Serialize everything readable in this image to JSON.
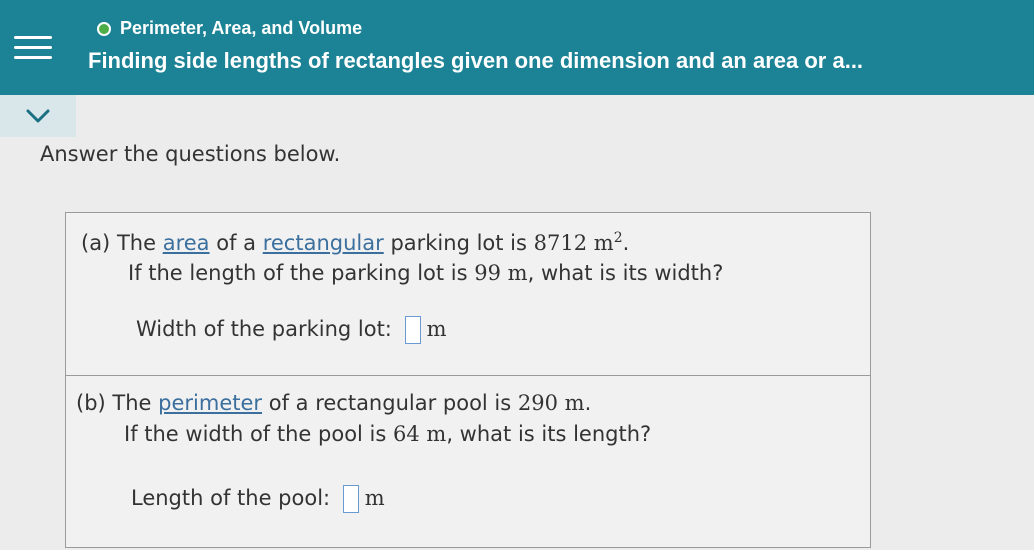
{
  "header": {
    "topic": "Perimeter, Area, and Volume",
    "title": "Finding side lengths of rectangles given one dimension and an area or a..."
  },
  "instructions": "Answer the questions below.",
  "question_a": {
    "label": "(a)",
    "t1": "The",
    "term1": "area",
    "t2": "of a",
    "term2": "rectangular",
    "t3": "parking lot is",
    "area_value": "8712 m",
    "area_exp": "2",
    "period": ".",
    "line2_pre": "If the length of the parking lot is",
    "length_value": "99 m",
    "line2_post": ", what is its width?",
    "answer_label": "Width of the parking lot:",
    "unit": "m"
  },
  "question_b": {
    "label": "(b)",
    "t1": "The",
    "term1": "perimeter",
    "t2": "of a rectangular pool is",
    "perimeter_value": "290 m",
    "period": ".",
    "line2_pre": "If the width of the pool is",
    "width_value": "64 m",
    "line2_post": ", what is its length?",
    "answer_label": "Length of the pool:",
    "unit": "m"
  }
}
